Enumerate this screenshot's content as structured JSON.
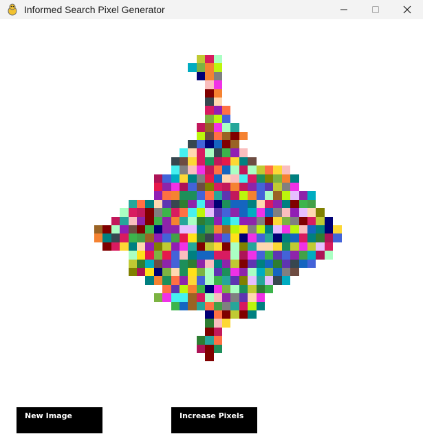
{
  "window": {
    "title": "Informed Search Pixel Generator",
    "app_icon": "pygame-snake-icon",
    "controls": {
      "minimize_icon": "minimize-icon",
      "maximize_icon": "maximize-icon",
      "close_icon": "close-icon"
    }
  },
  "buttons": {
    "new_image": "New Image",
    "increase_pixels": "Increase Pixels"
  },
  "colors": {
    "background": "#ffffff",
    "titlebar": "#f3f3f3",
    "button_bg": "#000000",
    "button_text": "#ffffff"
  },
  "palette": [
    "#e6194b",
    "#3cb44b",
    "#ffe119",
    "#4363d8",
    "#f58231",
    "#911eb4",
    "#46f0f0",
    "#f032e6",
    "#bcf60c",
    "#fabebe",
    "#008080",
    "#e6beff",
    "#9a6324",
    "#800000",
    "#aaffc3",
    "#808000",
    "#ffd8b1",
    "#000075",
    "#808080",
    "#1d8f5a",
    "#c2185b",
    "#5e35b1",
    "#26a69a",
    "#7cb342",
    "#c0ca33",
    "#ff7043",
    "#6d4c41",
    "#37474f",
    "#ad1457",
    "#00acc1",
    "#43a047",
    "#8e24aa",
    "#2e7d32",
    "#1565c0",
    "#d81b60",
    "#fdd835"
  ]
}
